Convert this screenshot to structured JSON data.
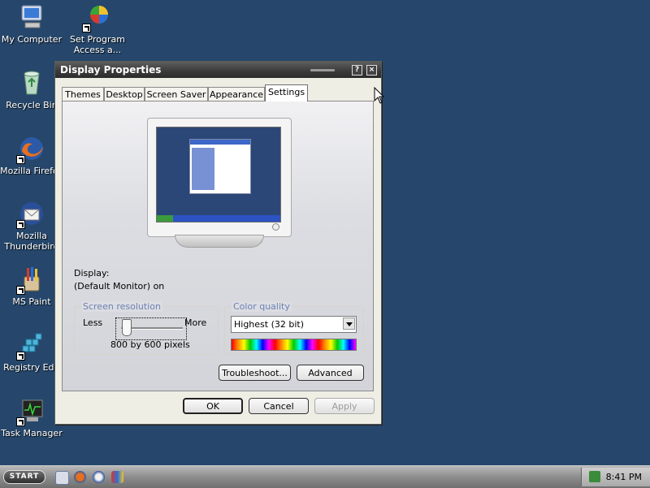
{
  "desktop": {
    "icons": [
      {
        "label": "My Computer",
        "icon": "my-computer-icon"
      },
      {
        "label": "Set Program Access a...",
        "icon": "set-program-access-icon"
      },
      {
        "label": "Recycle Bin",
        "icon": "recycle-bin-icon"
      },
      {
        "label": "Mozilla Firefox",
        "icon": "firefox-icon"
      },
      {
        "label": "Mozilla Thunderbird",
        "icon": "thunderbird-icon"
      },
      {
        "label": "MS Paint",
        "icon": "paint-icon"
      },
      {
        "label": "Registry Edit",
        "icon": "registry-editor-icon"
      },
      {
        "label": "Task Manager",
        "icon": "task-manager-icon"
      }
    ]
  },
  "window": {
    "title": "Display Properties",
    "help_button": "?",
    "close_button": "×",
    "tabs": [
      {
        "label": "Themes"
      },
      {
        "label": "Desktop"
      },
      {
        "label": "Screen Saver"
      },
      {
        "label": "Appearance"
      },
      {
        "label": "Settings",
        "active": true
      }
    ],
    "display_label": "Display:",
    "display_value": "(Default Monitor) on",
    "resolution": {
      "legend": "Screen resolution",
      "less": "Less",
      "more": "More",
      "value_text": "800 by 600 pixels",
      "slider_position_fraction": 0.0
    },
    "color_quality": {
      "legend": "Color quality",
      "selected": "Highest (32 bit)"
    },
    "buttons": {
      "troubleshoot": "Troubleshoot...",
      "advanced": "Advanced",
      "ok": "OK",
      "cancel": "Cancel",
      "apply": "Apply"
    }
  },
  "taskbar": {
    "start_label": "START",
    "quick_launch": [
      "show-desktop-icon",
      "firefox-icon",
      "thunderbird-icon",
      "paint-icon"
    ],
    "clock": "8:41 PM"
  },
  "colors": {
    "desktop_background": "#26476b",
    "legend_text": "#6d82b3"
  }
}
